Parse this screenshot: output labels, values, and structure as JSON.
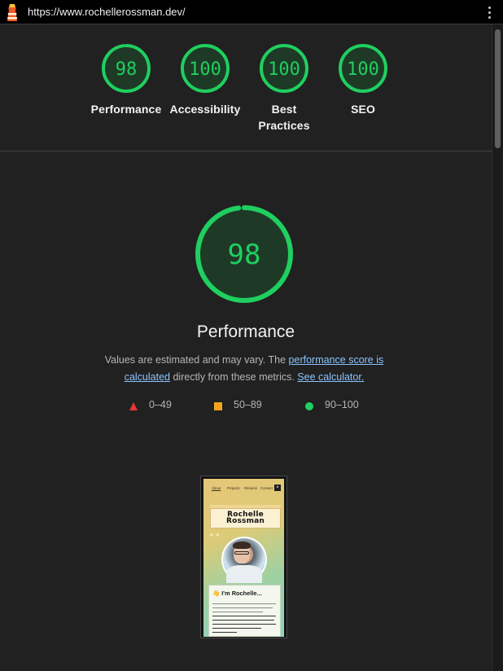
{
  "browser": {
    "url": "https://www.rochellerossman.dev/"
  },
  "summary_scores": [
    {
      "score": "98",
      "label": "Performance",
      "fraction": 0.98
    },
    {
      "score": "100",
      "label": "Accessibility",
      "fraction": 1.0
    },
    {
      "score": "100",
      "label": "Best\nPractices",
      "label_line1": "Best",
      "label_line2": "Practices",
      "fraction": 1.0
    },
    {
      "score": "100",
      "label": "SEO",
      "fraction": 1.0
    }
  ],
  "performance": {
    "score": "98",
    "fraction": 0.98,
    "title": "Performance",
    "desc_prefix": "Values are estimated and may vary. The ",
    "desc_link1": "performance score is calculated",
    "desc_link1_a": "performance score is",
    "desc_link1_b": "calculated",
    "desc_middle": " directly from these metrics. ",
    "desc_link2": "See calculator."
  },
  "legend": [
    {
      "range": "0–49",
      "shape": "triangle",
      "color": "#e53935"
    },
    {
      "range": "50–89",
      "shape": "square",
      "color": "#f4a51c"
    },
    {
      "range": "90–100",
      "shape": "circle",
      "color": "#1fcf60"
    }
  ],
  "colors": {
    "pass": "#1fcf60",
    "gauge_fill": "#1e3a26",
    "background": "#212121"
  },
  "thumbnail": {
    "nav": [
      "About",
      "Projects",
      "Résumé",
      "Contact"
    ],
    "name": "Rochelle Rossman",
    "name_line1": "Rochelle",
    "name_line2": "Rossman",
    "greeting": "👋 I'm Rochelle..."
  }
}
